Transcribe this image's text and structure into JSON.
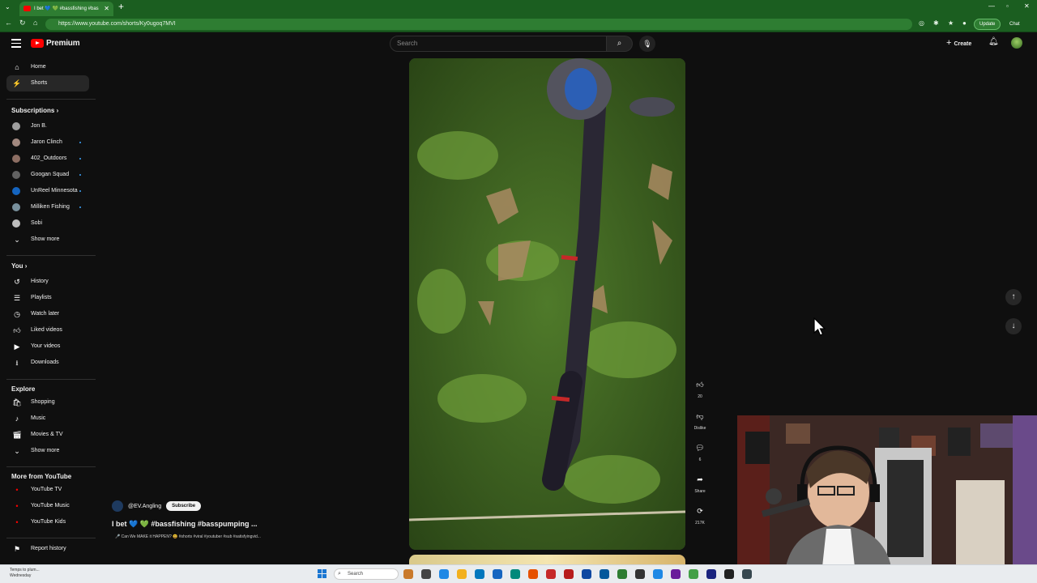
{
  "browser": {
    "tab_title": "I bet 💙 💚 #bassfishing #bas",
    "url": "https://www.youtube.com/shorts/Ky0ugoq7MVI",
    "update_label": "Update",
    "chat_label": "Chat"
  },
  "masthead": {
    "logo_text": "Premium",
    "search_placeholder": "Search",
    "create_label": "Create"
  },
  "sidebar": {
    "main": [
      {
        "label": "Home",
        "icon": "home-icon"
      },
      {
        "label": "Shorts",
        "icon": "shorts-icon",
        "active": true
      }
    ],
    "subscriptions_header": "Subscriptions",
    "subscriptions": [
      {
        "label": "Jon B.",
        "color": "#9e9e9e",
        "new": false
      },
      {
        "label": "Jaron Clinch",
        "color": "#a1887f",
        "new": true
      },
      {
        "label": "402_Outdoors",
        "color": "#8d6e63",
        "new": true
      },
      {
        "label": "Googan Squad",
        "color": "#616161",
        "new": true
      },
      {
        "label": "UnReel Minnesota",
        "color": "#1565c0",
        "new": true
      },
      {
        "label": "Milliken Fishing",
        "color": "#78909c",
        "new": true
      },
      {
        "label": "Sobi",
        "color": "#bdbdbd",
        "new": false
      }
    ],
    "show_more_1": "Show more",
    "you_header": "You",
    "you": [
      {
        "label": "History",
        "icon": "history-icon"
      },
      {
        "label": "Playlists",
        "icon": "playlists-icon"
      },
      {
        "label": "Watch later",
        "icon": "watch-later-icon"
      },
      {
        "label": "Liked videos",
        "icon": "liked-icon"
      },
      {
        "label": "Your videos",
        "icon": "your-videos-icon"
      },
      {
        "label": "Downloads",
        "icon": "downloads-icon"
      }
    ],
    "explore_header": "Explore",
    "explore": [
      {
        "label": "Shopping",
        "icon": "shopping-icon"
      },
      {
        "label": "Music",
        "icon": "music-icon"
      },
      {
        "label": "Movies & TV",
        "icon": "movies-icon"
      }
    ],
    "show_more_2": "Show more",
    "more_header": "More from YouTube",
    "more": [
      {
        "label": "YouTube TV"
      },
      {
        "label": "YouTube Music"
      },
      {
        "label": "YouTube Kids"
      }
    ],
    "report_history": "Report history"
  },
  "short": {
    "channel": "@EV.Angling",
    "subscribe_label": "Subscribe",
    "title": "I bet 💙 💚 #bassfishing #basspumping ...",
    "subtitle": "🎤 Can We MAKE it HAPPEN? 😃 #shorts #viral #youtuber #sub #satisfyingvid..."
  },
  "actions": {
    "like_count": "20",
    "dislike_label": "Dislike",
    "comment_count": "6",
    "share_label": "Share",
    "remix_count": "217K"
  },
  "taskbar": {
    "weather_line1": "Temps to plum...",
    "weather_line2": "Wednesday",
    "search_label": "Search"
  }
}
